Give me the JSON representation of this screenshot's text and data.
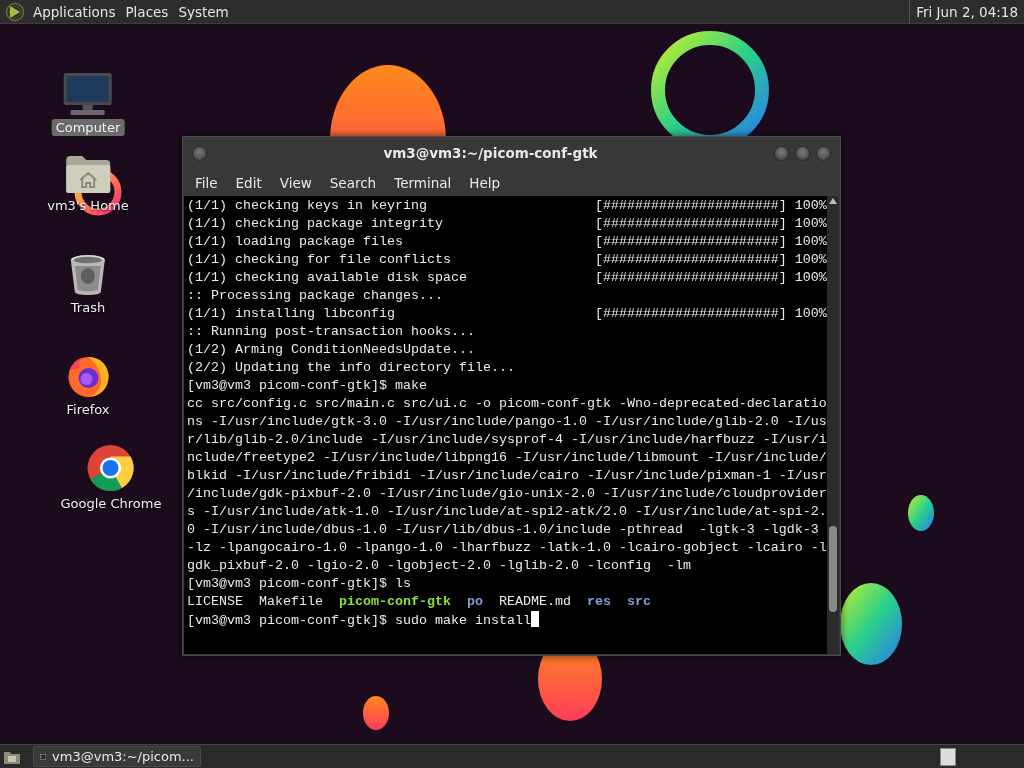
{
  "top_panel": {
    "menus": [
      "Applications",
      "Places",
      "System"
    ],
    "clock": "Fri Jun 2, 04:18"
  },
  "desktop_icons": [
    {
      "label": "Computer",
      "kind": "computer",
      "selected": true
    },
    {
      "label": "vm3's Home",
      "kind": "home",
      "selected": false
    },
    {
      "label": "Trash",
      "kind": "trash",
      "selected": false
    },
    {
      "label": "Firefox",
      "kind": "firefox",
      "selected": false
    },
    {
      "label": "Google Chrome",
      "kind": "chrome",
      "selected": false
    }
  ],
  "window": {
    "title": "vm3@vm3:~/picom-conf-gtk",
    "menu": [
      "File",
      "Edit",
      "View",
      "Search",
      "Terminal",
      "Help"
    ],
    "terminal": {
      "cursor": true,
      "lines": [
        {
          "kind": "text",
          "text": "(1/1) checking keys in keyring                     [######################] 100%"
        },
        {
          "kind": "text",
          "text": "(1/1) checking package integrity                   [######################] 100%"
        },
        {
          "kind": "text",
          "text": "(1/1) loading package files                        [######################] 100%"
        },
        {
          "kind": "text",
          "text": "(1/1) checking for file conflicts                  [######################] 100%"
        },
        {
          "kind": "text",
          "text": "(1/1) checking available disk space                [######################] 100%"
        },
        {
          "kind": "text",
          "text": ":: Processing package changes..."
        },
        {
          "kind": "text",
          "text": "(1/1) installing libconfig                         [######################] 100%"
        },
        {
          "kind": "text",
          "text": ":: Running post-transaction hooks..."
        },
        {
          "kind": "text",
          "text": "(1/2) Arming ConditionNeedsUpdate..."
        },
        {
          "kind": "text",
          "text": "(2/2) Updating the info directory file..."
        },
        {
          "kind": "text",
          "text": "[vm3@vm3 picom-conf-gtk]$ make"
        },
        {
          "kind": "text",
          "text": "cc src/config.c src/main.c src/ui.c -o picom-conf-gtk -Wno-deprecated-declaratio"
        },
        {
          "kind": "text",
          "text": "ns -I/usr/include/gtk-3.0 -I/usr/include/pango-1.0 -I/usr/include/glib-2.0 -I/us"
        },
        {
          "kind": "text",
          "text": "r/lib/glib-2.0/include -I/usr/include/sysprof-4 -I/usr/include/harfbuzz -I/usr/i"
        },
        {
          "kind": "text",
          "text": "nclude/freetype2 -I/usr/include/libpng16 -I/usr/include/libmount -I/usr/include/"
        },
        {
          "kind": "text",
          "text": "blkid -I/usr/include/fribidi -I/usr/include/cairo -I/usr/include/pixman-1 -I/usr"
        },
        {
          "kind": "text",
          "text": "/include/gdk-pixbuf-2.0 -I/usr/include/gio-unix-2.0 -I/usr/include/cloudprovider"
        },
        {
          "kind": "text",
          "text": "s -I/usr/include/atk-1.0 -I/usr/include/at-spi2-atk/2.0 -I/usr/include/at-spi-2."
        },
        {
          "kind": "text",
          "text": "0 -I/usr/include/dbus-1.0 -I/usr/lib/dbus-1.0/include -pthread  -lgtk-3 -lgdk-3"
        },
        {
          "kind": "text",
          "text": "-lz -lpangocairo-1.0 -lpango-1.0 -lharfbuzz -latk-1.0 -lcairo-gobject -lcairo -l"
        },
        {
          "kind": "text",
          "text": "gdk_pixbuf-2.0 -lgio-2.0 -lgobject-2.0 -lglib-2.0 -lconfig  -lm"
        },
        {
          "kind": "text",
          "text": "[vm3@vm3 picom-conf-gtk]$ ls"
        },
        {
          "kind": "listing",
          "entries": [
            {
              "text": "LICENSE",
              "kind": "file"
            },
            {
              "text": "Makefile",
              "kind": "file"
            },
            {
              "text": "picom-conf-gtk",
              "kind": "executable"
            },
            {
              "text": "po",
              "kind": "directory"
            },
            {
              "text": "README.md",
              "kind": "file"
            },
            {
              "text": "res",
              "kind": "directory"
            },
            {
              "text": "src",
              "kind": "directory"
            }
          ]
        },
        {
          "kind": "text",
          "text": "[vm3@vm3 picom-conf-gtk]$ sudo make install"
        }
      ]
    }
  },
  "taskbar": {
    "tasks": [
      {
        "label": "vm3@vm3:~/picom...",
        "selected": false
      }
    ]
  }
}
